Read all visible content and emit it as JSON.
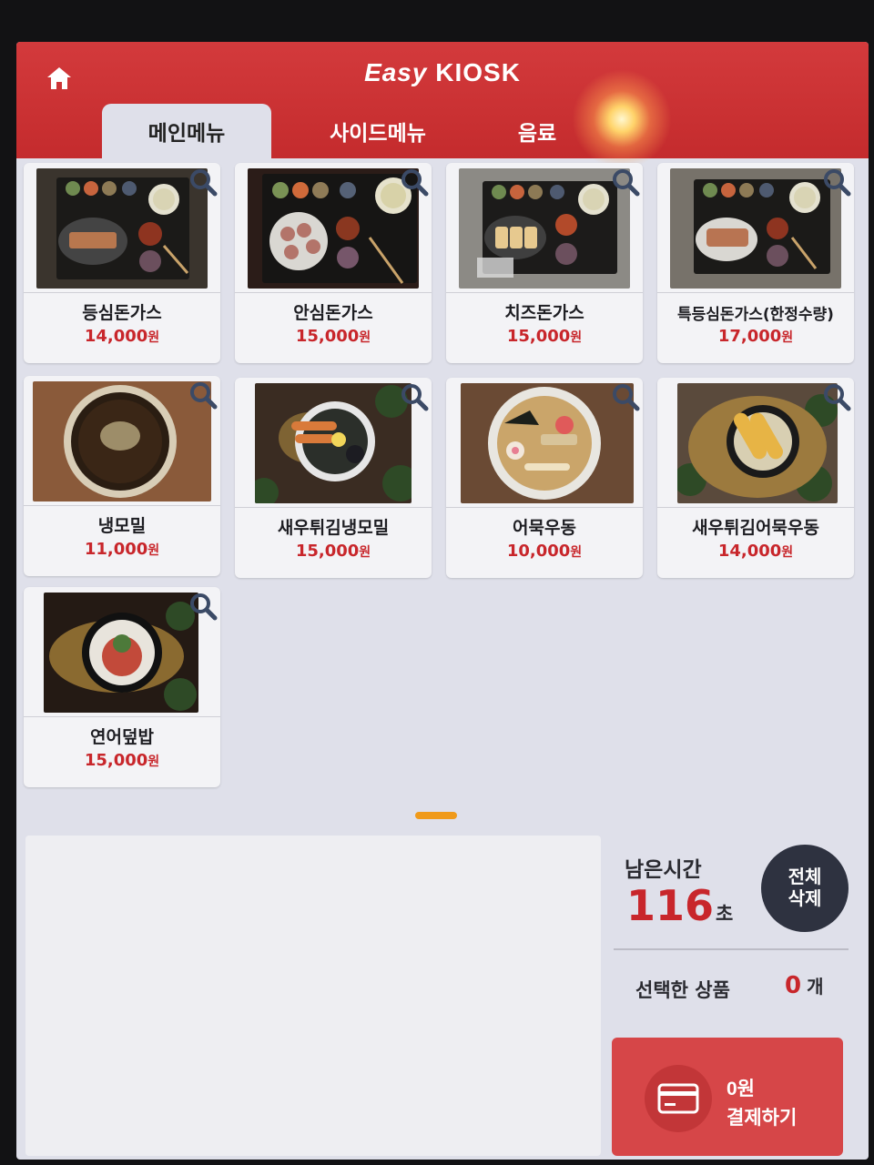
{
  "header": {
    "brand_easy": "Easy",
    "brand_kiosk": "KIOSK",
    "home_icon": "home-icon",
    "tabs": [
      {
        "label": "메인메뉴",
        "active": true
      },
      {
        "label": "사이드메뉴",
        "active": false
      },
      {
        "label": "음료",
        "active": false
      }
    ]
  },
  "menu": [
    {
      "name": "등심돈가스",
      "price": "14,000",
      "unit": "원",
      "photo": "tonkatsu set"
    },
    {
      "name": "안심돈가스",
      "price": "15,000",
      "unit": "원",
      "photo": "tonkatsu set"
    },
    {
      "name": "치즈돈가스",
      "price": "15,000",
      "unit": "원",
      "photo": "tonkatsu set"
    },
    {
      "name": "특등심돈가스(한정수량)",
      "price": "17,000",
      "unit": "원",
      "photo": "tonkatsu set"
    },
    {
      "name": "냉모밀",
      "price": "11,000",
      "unit": "원",
      "photo": "cold soba"
    },
    {
      "name": "새우튀김냉모밀",
      "price": "15,000",
      "unit": "원",
      "photo": "shrimp soba"
    },
    {
      "name": "어묵우동",
      "price": "10,000",
      "unit": "원",
      "photo": "udon"
    },
    {
      "name": "새우튀김어묵우동",
      "price": "14,000",
      "unit": "원",
      "photo": "shrimp udon"
    },
    {
      "name": "연어덮밥",
      "price": "15,000",
      "unit": "원",
      "photo": "salmon bowl"
    }
  ],
  "summary": {
    "remaining_label": "남은시간",
    "remaining_value": "116",
    "remaining_unit": "초",
    "clear_label_1": "전체",
    "clear_label_2": "삭제",
    "selected_label": "선택한 상품",
    "selected_count": "0",
    "selected_unit": "개"
  },
  "payment": {
    "amount": "0원",
    "label": "결제하기",
    "icon": "credit-card-icon"
  },
  "colors": {
    "brand_red": "#c8262b",
    "header_red": "#d33a3c",
    "dark_button": "#2e3240",
    "pay_button": "#d64648"
  }
}
